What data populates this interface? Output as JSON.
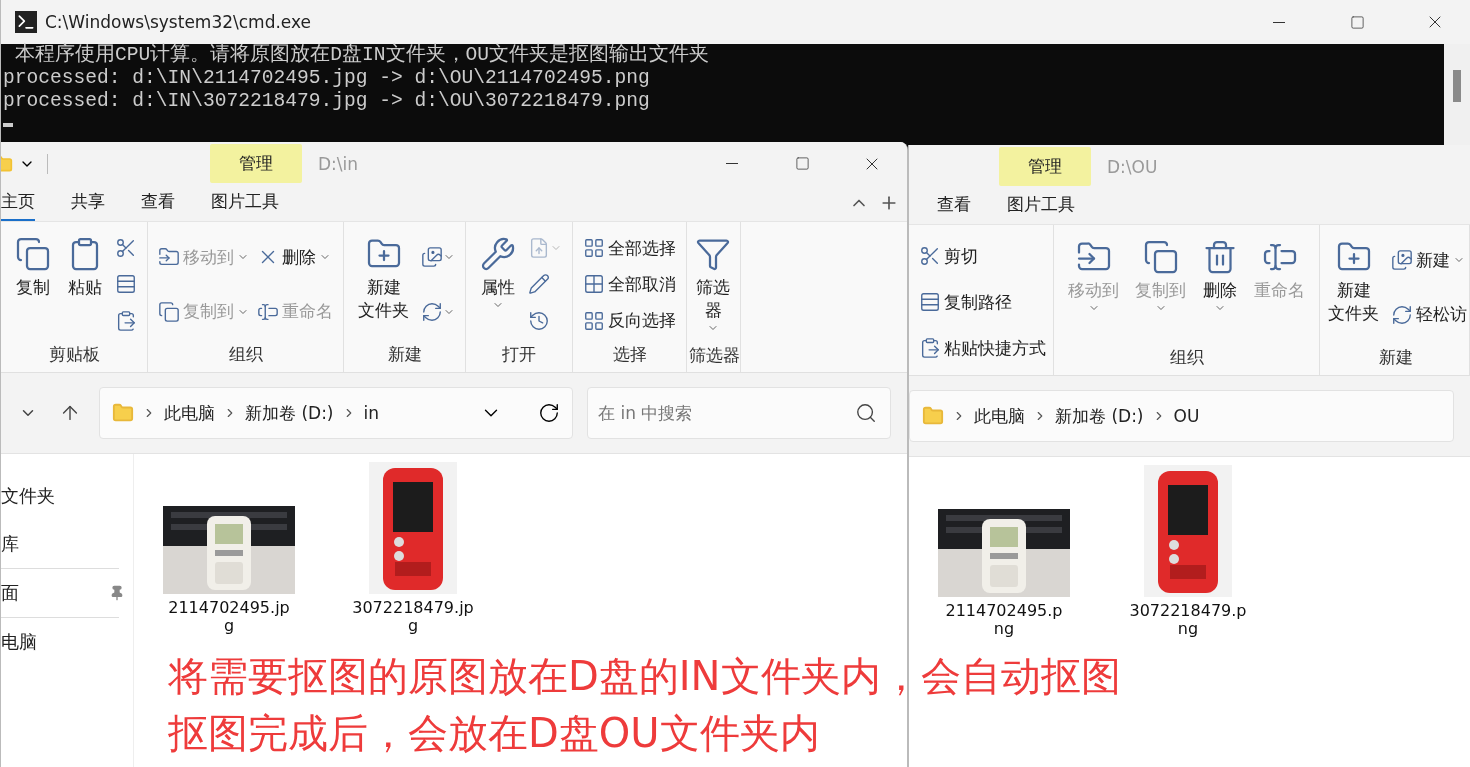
{
  "console": {
    "title": "C:\\Windows\\system32\\cmd.exe",
    "lines": [
      "本程序使用CPU计算。请将原图放在D盘IN文件夹，OU文件夹是抠图输出文件夹",
      "processed: d:\\IN\\2114702495.jpg -> d:\\OU\\2114702495.png",
      "processed: d:\\IN\\3072218479.jpg -> d:\\OU\\3072218479.png"
    ]
  },
  "explorer_windows": [
    {
      "context_tab": "管理",
      "path": "D:\\in",
      "tabs": [
        {
          "label": "主页",
          "selected": true
        },
        {
          "label": "共享",
          "selected": false
        },
        {
          "label": "查看",
          "selected": false
        },
        {
          "label": "图片工具",
          "selected": false
        }
      ],
      "ribbon_groups": [
        {
          "label": "剪贴板",
          "columns": [
            [
              {
                "kind": "large",
                "label": "复制",
                "disabled": false,
                "dropdown": false
              }
            ],
            [
              {
                "kind": "large",
                "label": "粘贴",
                "disabled": false,
                "dropdown": false
              }
            ],
            [
              {
                "kind": "icon",
                "disabled": false,
                "dropdown": false
              },
              {
                "kind": "icon",
                "disabled": false,
                "dropdown": false
              },
              {
                "kind": "icon",
                "disabled": false,
                "dropdown": false
              }
            ]
          ]
        },
        {
          "label": "组织",
          "columns": [
            [
              {
                "kind": "small",
                "label": "移动到",
                "disabled": true,
                "dropdown": true
              },
              {
                "kind": "small",
                "label": "复制到",
                "disabled": true,
                "dropdown": true
              }
            ],
            [
              {
                "kind": "small",
                "label": "删除",
                "disabled": false,
                "dropdown": true
              },
              {
                "kind": "small",
                "label": "重命名",
                "disabled": true,
                "dropdown": false
              }
            ]
          ]
        },
        {
          "label": "新建",
          "columns": [
            [
              {
                "kind": "large",
                "label_lines": [
                  "新建",
                  "文件夹"
                ],
                "disabled": false,
                "dropdown": false
              }
            ],
            [
              {
                "kind": "icon",
                "disabled": false,
                "dropdown": true
              },
              {
                "kind": "icon",
                "disabled": false,
                "dropdown": true
              }
            ]
          ]
        },
        {
          "label": "打开",
          "columns": [
            [
              {
                "kind": "large",
                "label": "属性",
                "disabled": false,
                "dropdown": true
              }
            ],
            [
              {
                "kind": "icon",
                "disabled": true,
                "dropdown": true
              },
              {
                "kind": "icon",
                "disabled": false,
                "dropdown": false
              },
              {
                "kind": "icon",
                "disabled": false,
                "dropdown": false
              }
            ]
          ]
        },
        {
          "label": "选择",
          "columns": [
            [
              {
                "kind": "small",
                "label": "全部选择",
                "disabled": false,
                "dropdown": false
              },
              {
                "kind": "small",
                "label": "全部取消",
                "disabled": false,
                "dropdown": false
              },
              {
                "kind": "small",
                "label": "反向选择",
                "disabled": false,
                "dropdown": false
              }
            ]
          ]
        },
        {
          "label": "筛选器",
          "columns": [
            [
              {
                "kind": "large",
                "label_lines": [
                  "筛选",
                  "器"
                ],
                "disabled": false,
                "dropdown": true
              }
            ]
          ]
        }
      ],
      "breadcrumb": [
        "此电脑",
        "新加卷 (D:)",
        "in"
      ],
      "search": {
        "placeholder": "在 in 中搜索"
      },
      "nav_items": [
        {
          "label": "文件夹",
          "pinned": false
        },
        {
          "label": "库",
          "pinned": false
        },
        {
          "label": "面",
          "pinned": true
        },
        {
          "label": "电脑",
          "pinned": false
        }
      ],
      "files": [
        {
          "name": "2114702495.jpg",
          "kind": "landscape"
        },
        {
          "name": "3072218479.jpg",
          "kind": "portrait"
        }
      ]
    },
    {
      "context_tab": "管理",
      "path": "D:\\OU",
      "tabs": [
        {
          "label": "查看",
          "selected": false
        },
        {
          "label": "图片工具",
          "selected": false
        }
      ],
      "ribbon_groups": [
        {
          "columns": [
            [
              {
                "kind": "small",
                "label": "剪切",
                "disabled": false,
                "dropdown": false
              },
              {
                "kind": "small",
                "label": "复制路径",
                "disabled": false,
                "dropdown": false
              },
              {
                "kind": "small",
                "label": "粘贴快捷方式",
                "disabled": false,
                "dropdown": false
              }
            ]
          ]
        },
        {
          "label": "组织",
          "columns": [
            [
              {
                "kind": "large",
                "label": "移动到",
                "disabled": true,
                "dropdown": true
              }
            ],
            [
              {
                "kind": "large",
                "label": "复制到",
                "disabled": true,
                "dropdown": true
              }
            ],
            [
              {
                "kind": "large",
                "label": "删除",
                "disabled": false,
                "dropdown": true
              }
            ],
            [
              {
                "kind": "large",
                "label": "重命名",
                "disabled": true,
                "dropdown": false
              }
            ]
          ]
        },
        {
          "label": "新建",
          "columns": [
            [
              {
                "kind": "large",
                "label_lines": [
                  "新建",
                  "文件夹"
                ],
                "disabled": false,
                "dropdown": false
              }
            ],
            [
              {
                "kind": "small",
                "label": "新建",
                "disabled": false,
                "dropdown": true
              },
              {
                "kind": "small",
                "label": "轻松访",
                "disabled": false
              }
            ]
          ]
        }
      ],
      "breadcrumb": [
        "此电脑",
        "新加卷 (D:)",
        "OU"
      ],
      "files": [
        {
          "name": "2114702495.png",
          "kind": "landscape"
        },
        {
          "name": "3072218479.png",
          "kind": "portrait"
        }
      ]
    }
  ],
  "annotation": {
    "lines": [
      "将需要抠图的原图放在D盘的IN文件夹内，会自动抠图",
      "抠图完成后，会放在D盘OU文件夹内"
    ]
  }
}
